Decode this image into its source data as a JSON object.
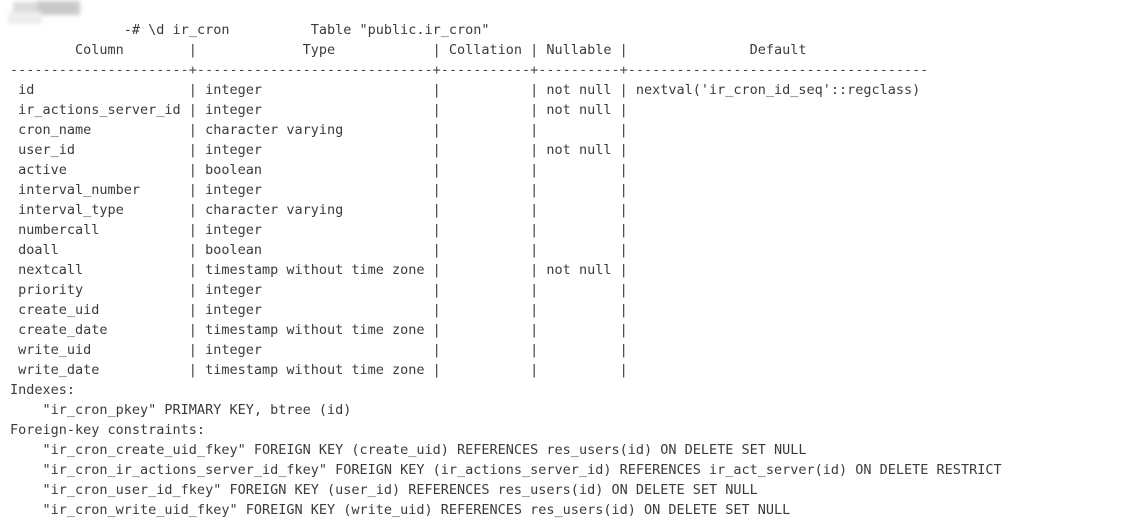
{
  "terminal": {
    "prompt": {
      "redacted_db": "",
      "prompt_suffix": "-# ",
      "command": "\\d ir_cron",
      "full_visible": "          -# \\d ir_cron"
    },
    "table_title": "                                     Table \"public.ir_cron\"",
    "header_row": "        Column        |             Type            | Collation | Nullable |               Default               ",
    "separator_row": "----------------------+-----------------------------+-----------+----------+-------------------------------------",
    "columns": [
      "Column",
      "Type",
      "Collation",
      "Nullable",
      "Default"
    ],
    "rows": [
      {
        "column": "id",
        "type": "integer",
        "collation": "",
        "nullable": "not null",
        "default": "nextval('ir_cron_id_seq'::regclass)",
        "line": " id                   | integer                     |           | not null | nextval('ir_cron_id_seq'::regclass)"
      },
      {
        "column": "ir_actions_server_id",
        "type": "integer",
        "collation": "",
        "nullable": "not null",
        "default": "",
        "line": " ir_actions_server_id | integer                     |           | not null | "
      },
      {
        "column": "cron_name",
        "type": "character varying",
        "collation": "",
        "nullable": "",
        "default": "",
        "line": " cron_name            | character varying           |           |          | "
      },
      {
        "column": "user_id",
        "type": "integer",
        "collation": "",
        "nullable": "not null",
        "default": "",
        "line": " user_id              | integer                     |           | not null | "
      },
      {
        "column": "active",
        "type": "boolean",
        "collation": "",
        "nullable": "",
        "default": "",
        "line": " active               | boolean                     |           |          | "
      },
      {
        "column": "interval_number",
        "type": "integer",
        "collation": "",
        "nullable": "",
        "default": "",
        "line": " interval_number      | integer                     |           |          | "
      },
      {
        "column": "interval_type",
        "type": "character varying",
        "collation": "",
        "nullable": "",
        "default": "",
        "line": " interval_type        | character varying           |           |          | "
      },
      {
        "column": "numbercall",
        "type": "integer",
        "collation": "",
        "nullable": "",
        "default": "",
        "line": " numbercall           | integer                     |           |          | "
      },
      {
        "column": "doall",
        "type": "boolean",
        "collation": "",
        "nullable": "",
        "default": "",
        "line": " doall                | boolean                     |           |          | "
      },
      {
        "column": "nextcall",
        "type": "timestamp without time zone",
        "collation": "",
        "nullable": "not null",
        "default": "",
        "line": " nextcall             | timestamp without time zone |           | not null | "
      },
      {
        "column": "priority",
        "type": "integer",
        "collation": "",
        "nullable": "",
        "default": "",
        "line": " priority             | integer                     |           |          | "
      },
      {
        "column": "create_uid",
        "type": "integer",
        "collation": "",
        "nullable": "",
        "default": "",
        "line": " create_uid           | integer                     |           |          | "
      },
      {
        "column": "create_date",
        "type": "timestamp without time zone",
        "collation": "",
        "nullable": "",
        "default": "",
        "line": " create_date          | timestamp without time zone |           |          | "
      },
      {
        "column": "write_uid",
        "type": "integer",
        "collation": "",
        "nullable": "",
        "default": "",
        "line": " write_uid            | integer                     |           |          | "
      },
      {
        "column": "write_date",
        "type": "timestamp without time zone",
        "collation": "",
        "nullable": "",
        "default": "",
        "line": " write_date           | timestamp without time zone |           |          | "
      }
    ],
    "indexes_header": "Indexes:",
    "indexes": [
      "    \"ir_cron_pkey\" PRIMARY KEY, btree (id)"
    ],
    "fk_header": "Foreign-key constraints:",
    "foreign_keys": [
      "    \"ir_cron_create_uid_fkey\" FOREIGN KEY (create_uid) REFERENCES res_users(id) ON DELETE SET NULL",
      "    \"ir_cron_ir_actions_server_id_fkey\" FOREIGN KEY (ir_actions_server_id) REFERENCES ir_act_server(id) ON DELETE RESTRICT",
      "    \"ir_cron_user_id_fkey\" FOREIGN KEY (user_id) REFERENCES res_users(id) ON DELETE SET NULL",
      "    \"ir_cron_write_uid_fkey\" FOREIGN KEY (write_uid) REFERENCES res_users(id) ON DELETE SET NULL"
    ]
  },
  "colors": {
    "background": "#ffffff",
    "text": "#3b3b3b",
    "redaction": "#dcdcdc"
  }
}
